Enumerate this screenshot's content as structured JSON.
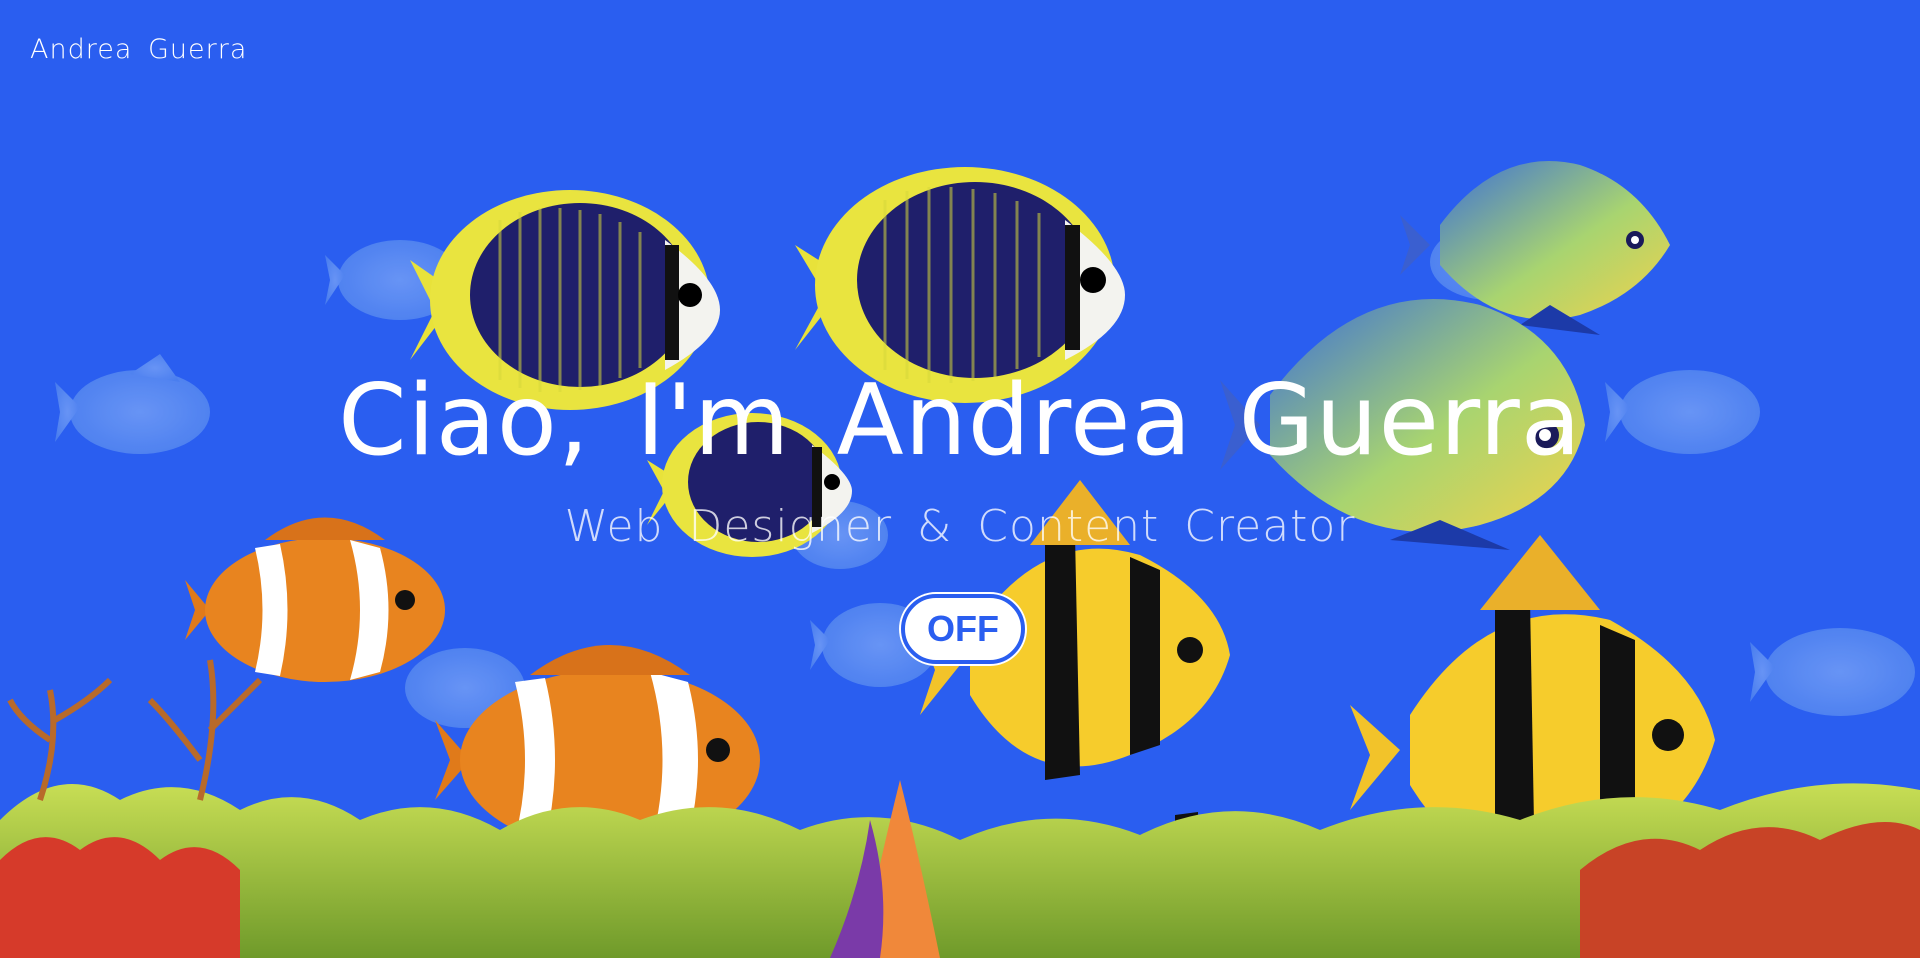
{
  "header": {
    "brand": "Andrea Guerra"
  },
  "hero": {
    "title": "Ciao, I'm Andrea Guerra",
    "subtitle": "Web Designer & Content Creator"
  },
  "toggle": {
    "label": "OFF"
  },
  "colors": {
    "background": "#2a5ef0",
    "text": "#ffffff"
  }
}
